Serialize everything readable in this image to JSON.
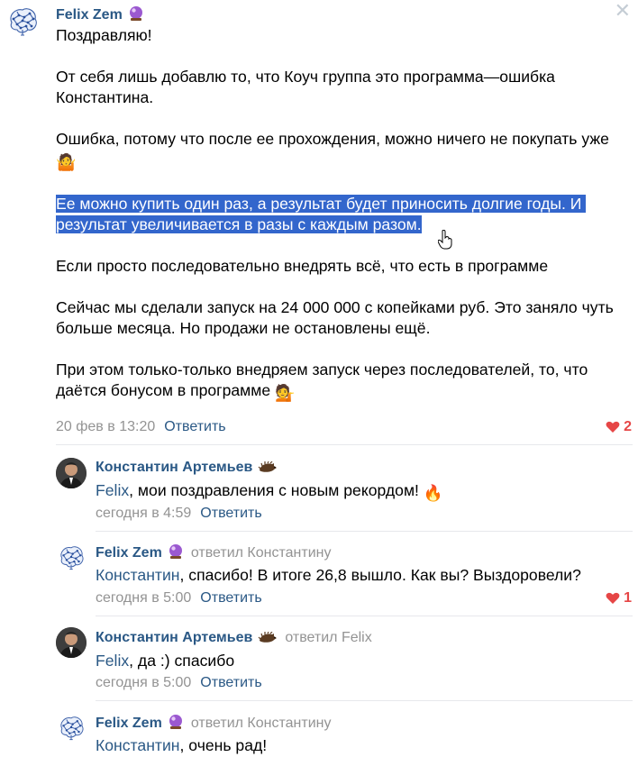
{
  "post": {
    "author": "Felix Zem",
    "author_badge": "crystal-ball",
    "paragraphs": [
      "Поздравляю!",
      "От себя лишь добавлю то, что Коуч группа это программа—ошибка Константина.",
      "Ошибка, потому что после ее прохождения, можно ничего не покупать уже"
    ],
    "highlighted": "Ее можно купить один раз, а результат будет приносить долгие годы. И результат увеличивается в разы с каждым разом.",
    "paragraphs_after": [
      "Если просто последовательно внедрять всё, что есть в программе",
      "Сейчас мы сделали запуск на 24 000 000 с копейками руб. Это заняло чуть больше месяца. Но продажи не остановлены ещё.",
      "При этом только-только внедряем запуск через последователей, то, что даётся бонусом в программе"
    ],
    "date": "20 фев в 13:20",
    "reply_label": "Ответить",
    "likes": "2"
  },
  "comments": [
    {
      "author": "Константин Артемьев",
      "reply_to": "",
      "mention": "Felix",
      "text": ", мои поздравления с новым рекордом!",
      "date": "сегодня в 4:59",
      "reply_label": "Ответить",
      "likes": ""
    },
    {
      "author": "Felix Zem",
      "reply_to": "ответил Константину",
      "mention": "Константин",
      "text": ", спасибо! В итоге 26,8 вышло. Как вы? Выздоровели?",
      "date": "сегодня в 5:00",
      "reply_label": "Ответить",
      "likes": "1"
    },
    {
      "author": "Константин Артемьев",
      "reply_to": "ответил Felix",
      "mention": "Felix",
      "text": ", да :) спасибо",
      "date": "сегодня в 5:00",
      "reply_label": "Ответить",
      "likes": ""
    },
    {
      "author": "Felix Zem",
      "reply_to": "ответил Константину",
      "mention": "Константин",
      "text": ", очень рад!",
      "date": "",
      "reply_label": "",
      "likes": ""
    }
  ],
  "colors": {
    "link": "#2a5885",
    "meta": "#939393",
    "like": "#e64646",
    "selection": "#3366cc"
  }
}
